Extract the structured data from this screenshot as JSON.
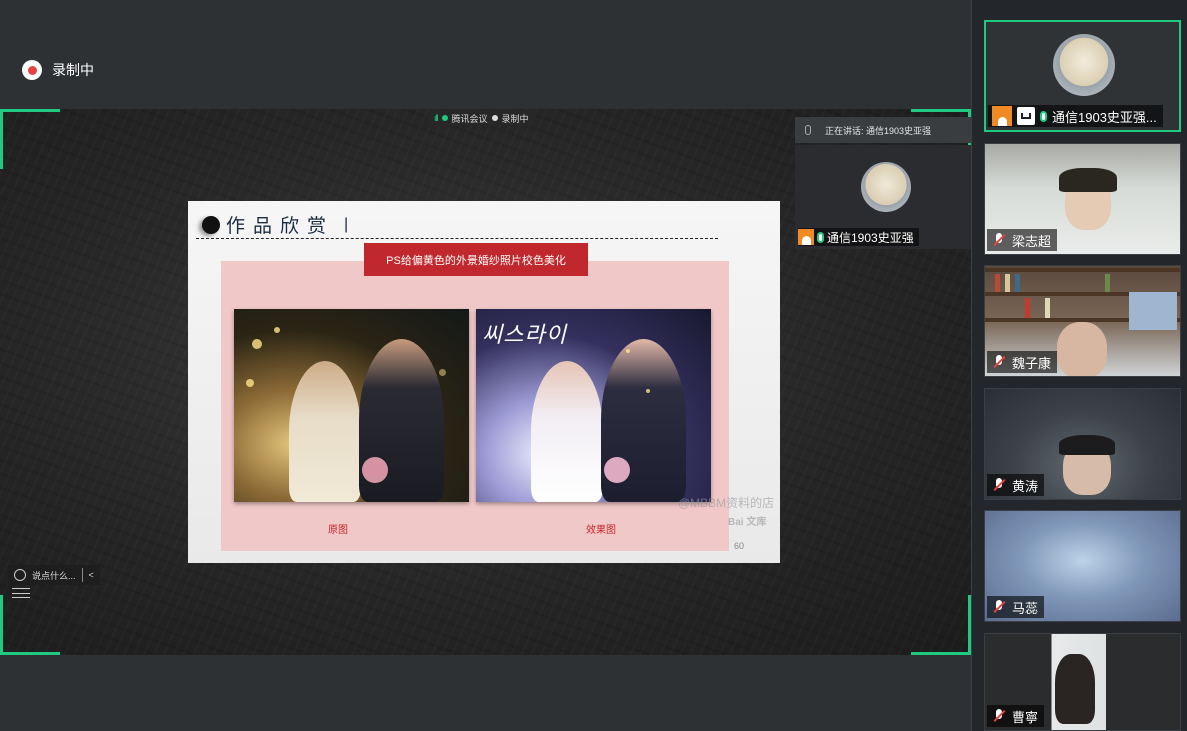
{
  "recording": {
    "label": "录制中"
  },
  "share_bar": {
    "app_name": "腾讯会议",
    "status": "录制中"
  },
  "speaking": {
    "text": "正在讲话: 通信1903史亚强"
  },
  "main_speaker": {
    "name": "通信1903史亚强"
  },
  "slide": {
    "title": "作品欣赏",
    "separator": "|",
    "banner": "PS给偏黄色的外景婚纱照片校色美化",
    "photo_left_caption": "原图",
    "photo_right_caption": "效果图",
    "photo_script_text": "씨스라이",
    "page_number": "60",
    "watermark_shop": "@MBBM资料的店",
    "watermark_brand": "Bai 文库"
  },
  "chat": {
    "placeholder": "说点什么...",
    "collapse_icon": "<"
  },
  "participants": [
    {
      "name": "通信1903史亚强...",
      "muted": false,
      "host": true,
      "sharing": true,
      "active": true
    },
    {
      "name": "梁志超",
      "muted": true
    },
    {
      "name": "魏子康",
      "muted": true
    },
    {
      "name": "黄涛",
      "muted": true
    },
    {
      "name": "马蕊",
      "muted": true
    },
    {
      "name": "曹寧",
      "muted": true
    }
  ],
  "colors": {
    "accent_green": "#1fc980",
    "banner_red": "#c0282d",
    "host_orange": "#f08a24",
    "mute_red": "#e64340"
  }
}
